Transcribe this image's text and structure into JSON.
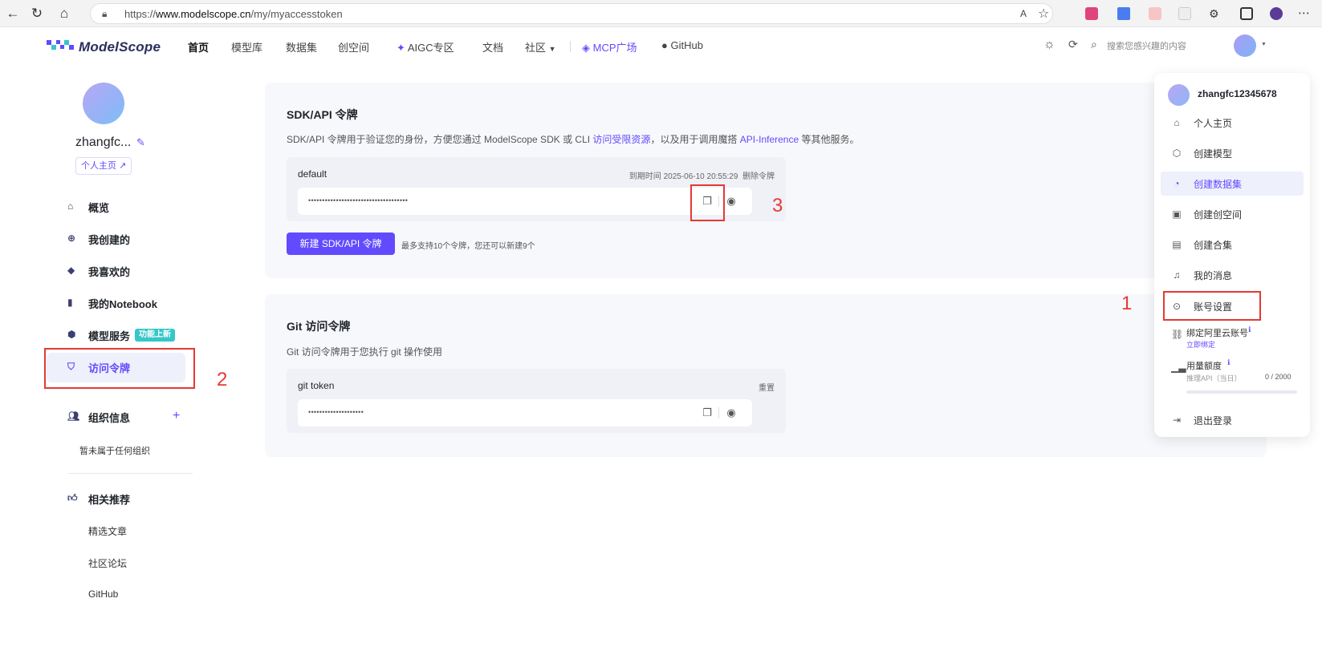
{
  "browser": {
    "url_prefix": "https://",
    "url_domain": "www.modelscope.cn",
    "url_path": "/my/myaccesstoken"
  },
  "topnav": {
    "logo_text": "ModelScope",
    "items": [
      "首页",
      "模型库",
      "数据集",
      "创空间",
      "AIGC专区",
      "文档",
      "社区",
      "MCP广场",
      "GitHub"
    ],
    "search_placeholder": "搜索您感兴趣的内容"
  },
  "sidebar": {
    "username": "zhangfc...",
    "profile_link": "个人主页",
    "items": [
      {
        "label": "概览",
        "icon": "home-icon"
      },
      {
        "label": "我创建的",
        "icon": "plus-circle-icon"
      },
      {
        "label": "我喜欢的",
        "icon": "diamond-icon"
      },
      {
        "label": "我的Notebook",
        "icon": "notebook-icon"
      },
      {
        "label": "模型服务",
        "icon": "cube-icon"
      },
      {
        "label": "访问令牌",
        "icon": "shield-icon"
      }
    ],
    "badge_new": "功能上新",
    "org_label": "组织信息",
    "org_empty": "暂未属于任何组织",
    "related_label": "相关推荐",
    "related_items": [
      "精选文章",
      "社区论坛",
      "GitHub"
    ]
  },
  "sdk": {
    "title": "SDK/API 令牌",
    "desc_1": "SDK/API 令牌用于验证您的身份，方便您通过 ModelScope SDK 或 CLI ",
    "desc_link_1": "访问受限资源",
    "desc_2": "，以及用于调用魔搭 ",
    "desc_link_2": "API-Inference",
    "desc_3": " 等其他服务。",
    "token_name": "default",
    "expire": "到期时间 2025-06-10 20:55:29",
    "delete": "删除令牌",
    "token_masked": "••••••••••••••••••••••••••••••••••••",
    "new_button": "新建 SDK/API 令牌",
    "hint": "最多支持10个令牌，您还可以新建9个"
  },
  "git": {
    "title": "Git 访问令牌",
    "desc": "Git 访问令牌用于您执行 git 操作使用",
    "token_name": "git token",
    "reset": "重置",
    "token_masked": "••••••••••••••••••••"
  },
  "menu": {
    "username": "zhangfc12345678",
    "items": [
      {
        "label": "个人主页",
        "icon": "home-icon"
      },
      {
        "label": "创建模型",
        "icon": "cube-icon"
      },
      {
        "label": "创建数据集",
        "icon": "dataset-icon"
      },
      {
        "label": "创建创空间",
        "icon": "space-icon"
      },
      {
        "label": "创建合集",
        "icon": "collection-icon"
      },
      {
        "label": "我的消息",
        "icon": "bell-icon"
      },
      {
        "label": "账号设置",
        "icon": "settings-icon"
      }
    ],
    "bind_aliyun": "绑定阿里云账号",
    "bind_now": "立即绑定",
    "quota_label": "用量额度",
    "quota_sub": "推理API（当日）",
    "quota_value": "0 / 2000",
    "quota_used_fraction": 0,
    "logout": "退出登录"
  },
  "annotations": [
    "1",
    "2",
    "3"
  ],
  "colors": {
    "accent": "#624aff",
    "annotation": "#e53935"
  }
}
